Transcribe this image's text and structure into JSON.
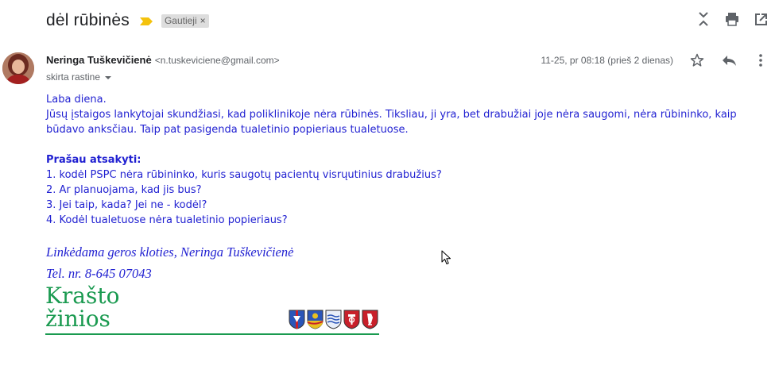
{
  "subject": "dėl rūbinės",
  "label": {
    "name": "Gautieji",
    "remove": "×"
  },
  "icons": {
    "top": [
      "collapse-all-icon",
      "print-icon",
      "open-in-new-window-icon"
    ],
    "message": [
      "star-icon",
      "reply-icon",
      "more-vert-icon"
    ]
  },
  "sender": {
    "name": "Neringa Tuškevičienė",
    "email": "<n.tuskeviciene@gmail.com>",
    "to": "skirta rastine",
    "date": "11-25, pr 08:18 (prieš 2 dienas)"
  },
  "body": {
    "greeting": "Laba diena.",
    "para1_line1": "Jūsų įstaigos lankytojai skundžiasi, kad poliklinikoje nėra rūbinės. Tiksliau, ji yra, bet drabužiai joje nėra saugomi, nėra rūbininko, kaip",
    "para1_line2": "būdavo anksčiau. Taip pat pasigenda tualetinio popieriaus tualetuose.",
    "ask": "Prašau atsakyti:",
    "questions": [
      "1. kodėl PSPC nėra rūbininko, kuris saugotų pacientų visrųutinius drabužius?",
      "2. Ar planuojama, kad jis bus?",
      "3. Jei taip, kada? Jei ne - kodėl?",
      "4. Kodėl tualetuose nėra tualetinio popieriaus?"
    ]
  },
  "signature": {
    "line1": "Linkėdama geros kloties, Neringa Tuškevičienė",
    "line2": "Tel. nr. 8-645 07043"
  },
  "logo": {
    "line1": "Krašto",
    "line2": "žinios"
  },
  "colors": {
    "body_text": "#1f1fd1",
    "logo_green": "#1a9a50",
    "importance": "#f4c20d",
    "label_bg": "#dddddd"
  }
}
